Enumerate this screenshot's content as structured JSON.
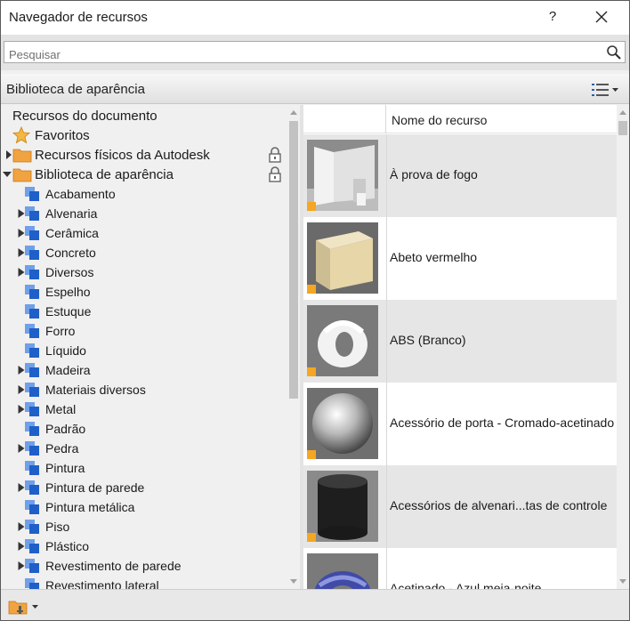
{
  "window": {
    "title": "Navegador de recursos",
    "help_label": "?"
  },
  "search": {
    "placeholder": "Pesquisar",
    "value": ""
  },
  "library_bar": {
    "title": "Biblioteca de aparência"
  },
  "tree": {
    "document_resources": "Recursos do documento",
    "favorites": "Favoritos",
    "autodesk_physical": "Recursos físicos da Autodesk",
    "appearance_library": "Biblioteca de aparência",
    "categories": [
      {
        "label": "Acabamento",
        "expandable": false
      },
      {
        "label": "Alvenaria",
        "expandable": true
      },
      {
        "label": "Cerâmica",
        "expandable": true
      },
      {
        "label": "Concreto",
        "expandable": true
      },
      {
        "label": "Diversos",
        "expandable": true
      },
      {
        "label": "Espelho",
        "expandable": false
      },
      {
        "label": "Estuque",
        "expandable": false
      },
      {
        "label": "Forro",
        "expandable": false
      },
      {
        "label": "Líquido",
        "expandable": false
      },
      {
        "label": "Madeira",
        "expandable": true
      },
      {
        "label": "Materiais diversos",
        "expandable": true
      },
      {
        "label": "Metal",
        "expandable": true
      },
      {
        "label": "Padrão",
        "expandable": false
      },
      {
        "label": "Pedra",
        "expandable": true
      },
      {
        "label": "Pintura",
        "expandable": false
      },
      {
        "label": "Pintura de parede",
        "expandable": true
      },
      {
        "label": "Pintura metálica",
        "expandable": false
      },
      {
        "label": "Piso",
        "expandable": true
      },
      {
        "label": "Plástico",
        "expandable": true
      },
      {
        "label": "Revestimento de parede",
        "expandable": true
      },
      {
        "label": "Revestimento lateral",
        "expandable": false
      }
    ]
  },
  "grid": {
    "column_header": "Nome do recurso",
    "rows": [
      {
        "name": "À prova de fogo",
        "thumb": "fireproof"
      },
      {
        "name": "Abeto vermelho",
        "thumb": "wood-cube"
      },
      {
        "name": "ABS (Branco)",
        "thumb": "white-plastic"
      },
      {
        "name": "Acessório de porta - Cromado-acetinado",
        "thumb": "chrome-sphere"
      },
      {
        "name": "Acessórios de alvenari...tas de controle",
        "thumb": "black-cylinder"
      },
      {
        "name": "Acetinado - Azul meia-noite",
        "thumb": "blue-torus"
      }
    ]
  },
  "colors": {
    "folder": "#f0a340",
    "tree_icon": "#2a6fd6",
    "badge": "#f5a623",
    "alt_row": "#e6e6e6"
  }
}
